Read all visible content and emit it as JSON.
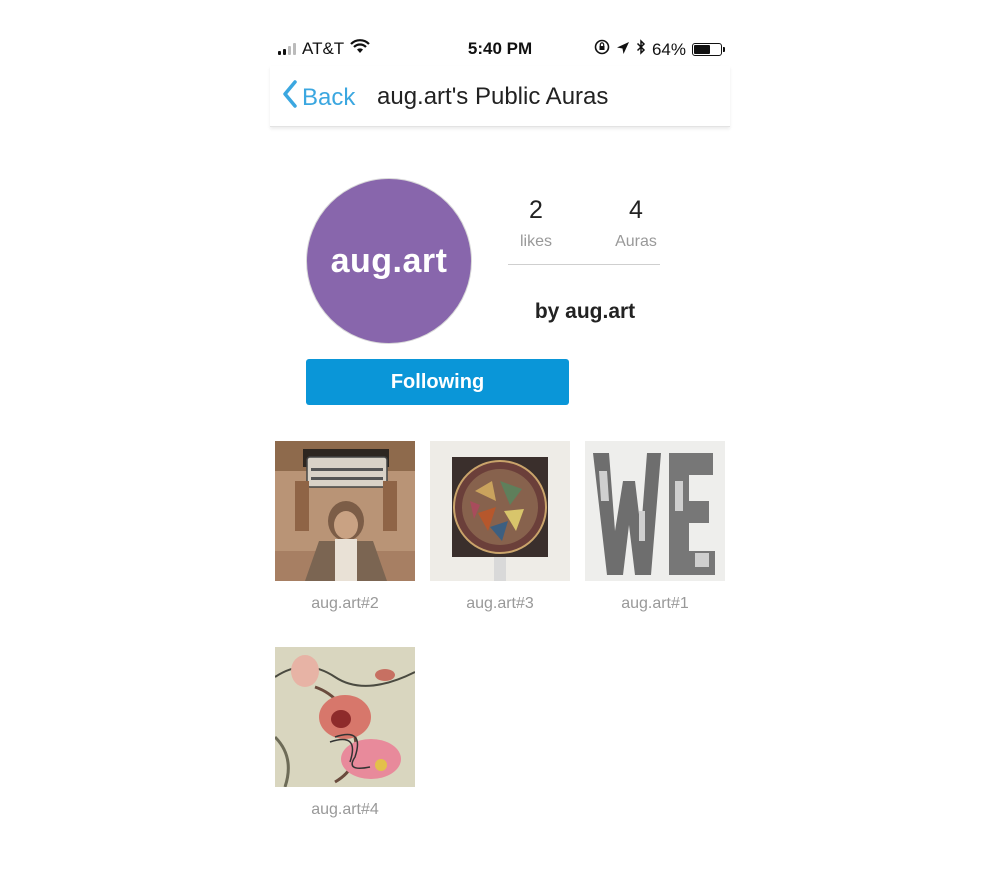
{
  "status_bar": {
    "carrier": "AT&T",
    "time": "5:40 PM",
    "battery": "64%",
    "battery_level": 0.64,
    "icons": [
      "signal-icon",
      "wifi-icon",
      "orientation-lock-icon",
      "location-arrow-icon",
      "bluetooth-icon",
      "battery-icon"
    ]
  },
  "nav": {
    "back_label": "Back",
    "title": "aug.art's Public Auras"
  },
  "profile": {
    "avatar_text": "aug.art",
    "avatar_color": "#8866ac",
    "likes_count": "2",
    "likes_label": "likes",
    "auras_count": "4",
    "auras_label": "Auras",
    "byline": "by aug.art",
    "follow_label": "Following",
    "follow_color": "#0a96d8"
  },
  "auras": [
    {
      "caption": "aug.art#2"
    },
    {
      "caption": "aug.art#3"
    },
    {
      "caption": "aug.art#1"
    },
    {
      "caption": "aug.art#4"
    }
  ]
}
